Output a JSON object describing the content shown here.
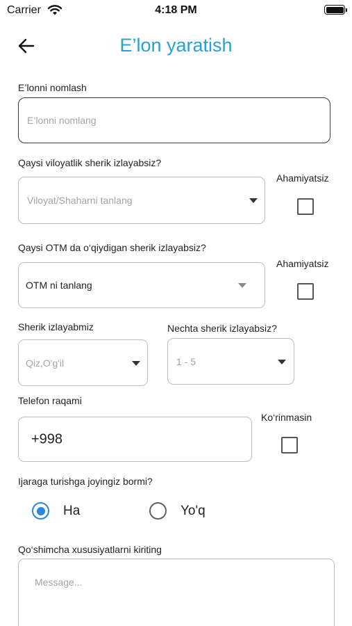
{
  "status_bar": {
    "carrier": "Carrier",
    "time": "4:18 PM"
  },
  "header": {
    "title": "E’lon yaratish"
  },
  "form": {
    "title_field": {
      "label": "E’lonni nomlash",
      "placeholder": "E’lonni nomlang"
    },
    "region": {
      "label": "Qaysi viloyatlik sherik izlayabsiz?",
      "placeholder": "Viloyat/Shaharni tanlang",
      "checkbox_label": "Ahamiyatsiz",
      "checked": false
    },
    "university": {
      "label": "Qaysi OTM da o‘qiydigan sherik izlayabsiz?",
      "value": "OTM ni tanlang",
      "checkbox_label": "Ahamiyatsiz",
      "checked": false
    },
    "gender": {
      "label": "Sherik izlayabmiz",
      "placeholder": "Qiz,O'g'il"
    },
    "count": {
      "label": "Nechta sherik izlayabsiz?",
      "placeholder": "1 - 5"
    },
    "phone": {
      "label": "Telefon raqami",
      "value": "+998",
      "checkbox_label": "Ko‘rinmasin",
      "checked": false
    },
    "housing": {
      "label": "Ijaraga turishga joyingiz bormi?",
      "options": [
        "Ha",
        "Yo'q"
      ],
      "selected": "Ha"
    },
    "extra": {
      "label": "Qo‘shimcha xususiyatlarni kiriting",
      "placeholder": "Message..."
    }
  }
}
